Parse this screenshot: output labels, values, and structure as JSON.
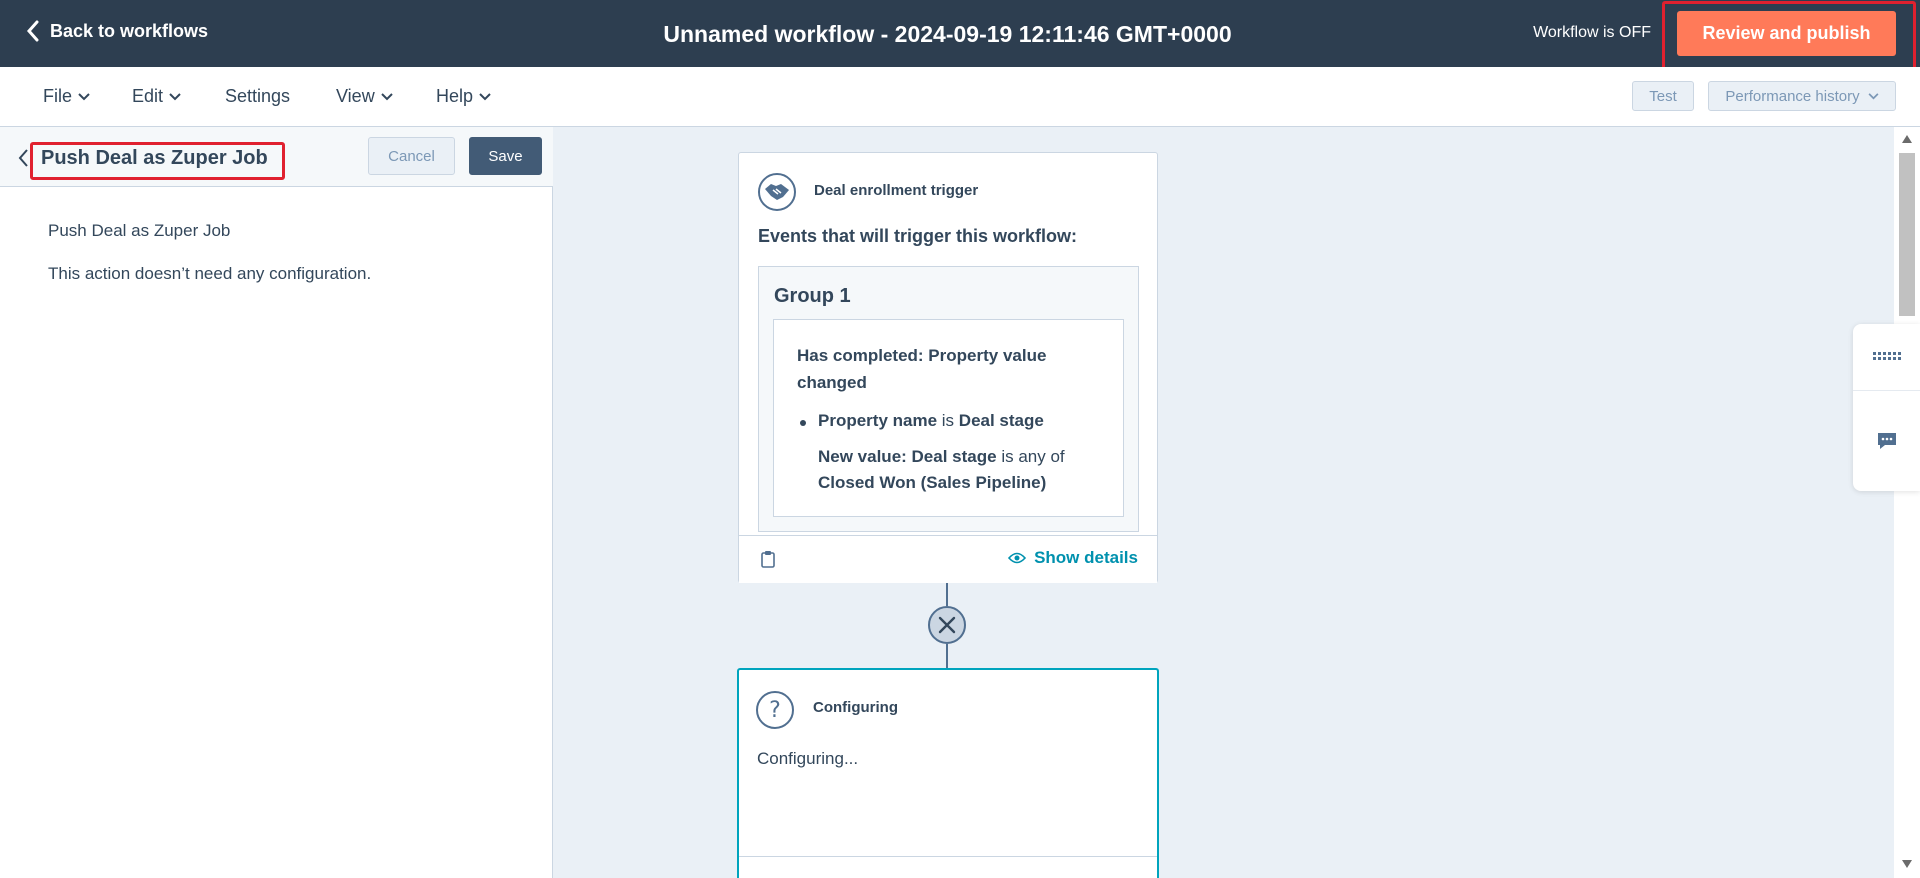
{
  "header": {
    "back_label": "Back to workflows",
    "title": "Unnamed workflow - 2024-09-19 12:11:46 GMT+0000",
    "status": "Workflow is OFF",
    "publish_label": "Review and publish"
  },
  "menubar": {
    "items": [
      "File",
      "Edit",
      "Settings",
      "View",
      "Help"
    ],
    "test_label": "Test",
    "history_label": "Performance history"
  },
  "left_panel": {
    "title": "Push Deal as Zuper Job",
    "cancel_label": "Cancel",
    "save_label": "Save",
    "action_name": "Push Deal as Zuper Job",
    "config_note": "This action doesn’t need any configuration."
  },
  "trigger_card": {
    "heading": "Deal enrollment trigger",
    "events_label": "Events that will trigger this workflow:",
    "group_title": "Group 1",
    "condition_title": "Has completed: Property value changed",
    "prop_name_label": "Property name",
    "prop_is": "is",
    "prop_value": "Deal stage",
    "new_value_label": "New value: Deal stage",
    "new_value_op": "is any of",
    "new_value_value": "Closed Won (Sales Pipeline)",
    "show_details": "Show details"
  },
  "config_card": {
    "heading": "Configuring",
    "body": "Configuring..."
  },
  "colors": {
    "header_bg": "#2d3e50",
    "publish_bg": "#ff7a59",
    "save_bg": "#425b76",
    "accent_teal": "#0091ae",
    "highlight_red": "#e0212f",
    "canvas_bg": "#eaf0f6"
  },
  "icons": {
    "back": "chevron-left-icon",
    "handshake": "handshake-icon",
    "clipboard": "clipboard-icon",
    "eye": "eye-icon",
    "remove": "close-icon",
    "question": "question-icon",
    "grid": "grid-icon",
    "chat": "chat-icon"
  }
}
